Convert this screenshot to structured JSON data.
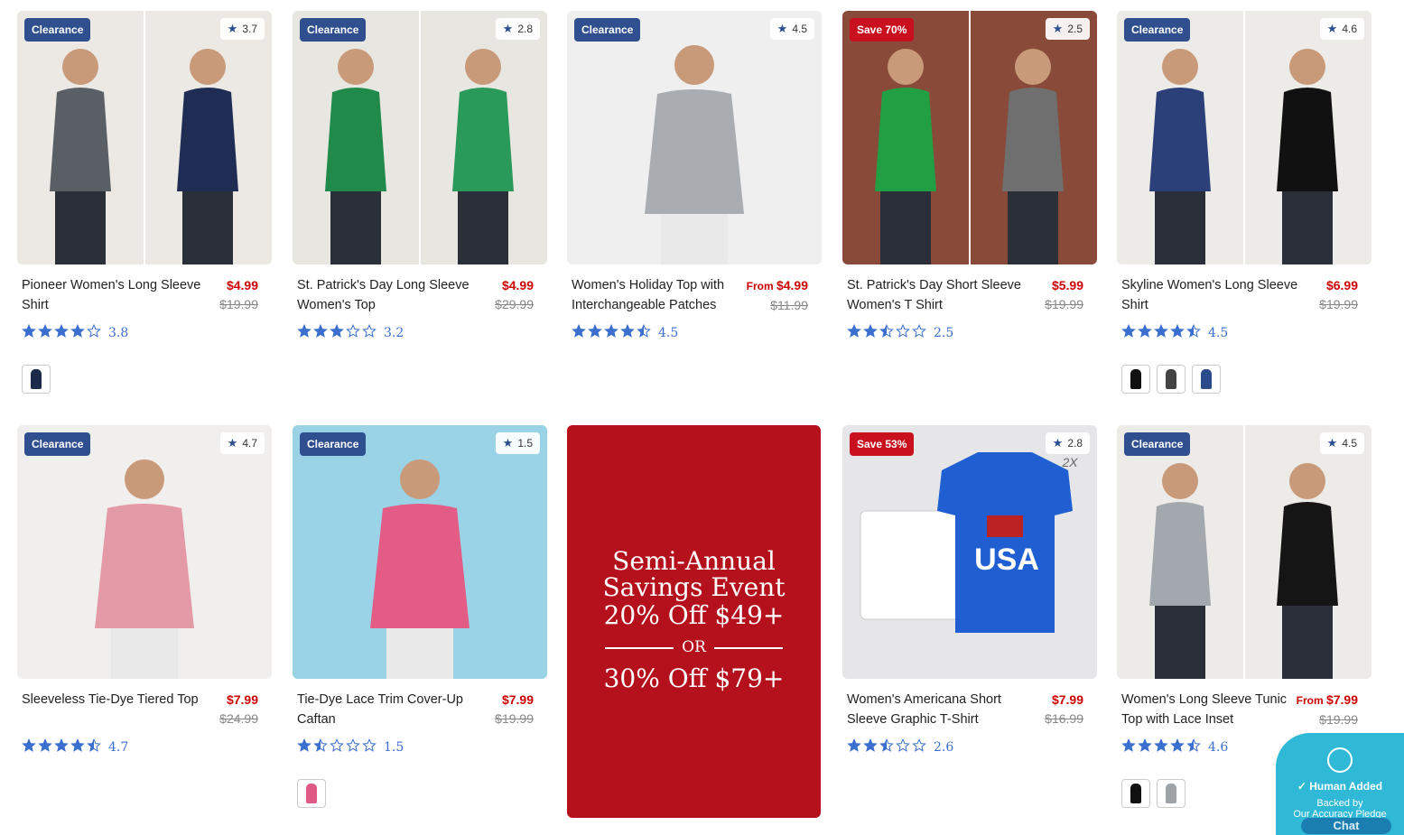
{
  "colors": {
    "clearance_badge": "#2f4f8f",
    "save_badge": "#c8101e",
    "price_red": "#cc0000",
    "star_blue": "#3a6ecf",
    "promo_bg": "#b5111c"
  },
  "products": [
    {
      "badge": "Clearance",
      "badge_type": "clearance",
      "rating": "3.7",
      "name": "Pioneer Women's Long Sleeve Shirt",
      "price_prefix": "",
      "price": "$4.99",
      "was": "$19.99",
      "stars_value": 3.8,
      "rating_text": "3.8",
      "swatch_colors": [
        "#1c2a4a"
      ],
      "art": [
        "#5a5f66",
        "#1f2d55"
      ],
      "bg": "#ece9e4"
    },
    {
      "badge": "Clearance",
      "badge_type": "clearance",
      "rating": "2.8",
      "name": "St. Patrick's Day Long Sleeve Women's Top",
      "price_prefix": "",
      "price": "$4.99",
      "was": "$29.99",
      "stars_value": 3.2,
      "rating_text": "3.2",
      "swatch_colors": [],
      "art": [
        "#1f8a4a",
        "#2a9a5a"
      ],
      "bg": "#e8e6e0"
    },
    {
      "badge": "Clearance",
      "badge_type": "clearance",
      "rating": "4.5",
      "name": "Women's Holiday Top with Interchangeable Patches",
      "price_prefix": "From ",
      "price": "$4.99",
      "was": "$11.99",
      "stars_value": 4.5,
      "rating_text": "4.5",
      "swatch_colors": [],
      "art": [
        "#a9acb1"
      ],
      "bg": "#efefef"
    },
    {
      "badge": "Save 70%",
      "badge_type": "save",
      "rating": "2.5",
      "name": "St. Patrick's Day Short Sleeve Women's T Shirt",
      "price_prefix": "",
      "price": "$5.99",
      "was": "$19.99",
      "stars_value": 2.5,
      "rating_text": "2.5",
      "swatch_colors": [],
      "art": [
        "#21a043",
        "#6f6f6f"
      ],
      "bg": "#8a4a3a"
    },
    {
      "badge": "Clearance",
      "badge_type": "clearance",
      "rating": "4.6",
      "name": "Skyline Women's Long Sleeve Shirt",
      "price_prefix": "",
      "price": "$6.99",
      "was": "$19.99",
      "stars_value": 4.5,
      "rating_text": "4.5",
      "swatch_colors": [
        "#111111",
        "#444444",
        "#2b4a8a"
      ],
      "art": [
        "#2b3f78",
        "#111111"
      ],
      "bg": "#ecebe8"
    },
    {
      "badge": "Clearance",
      "badge_type": "clearance",
      "rating": "4.7",
      "name": "Sleeveless Tie-Dye Tiered Top",
      "price_prefix": "",
      "price": "$7.99",
      "was": "$24.99",
      "stars_value": 4.7,
      "rating_text": "4.7",
      "swatch_colors": [],
      "art": [
        "#e49aa6"
      ],
      "bg": "#f0efed"
    },
    {
      "badge": "Clearance",
      "badge_type": "clearance",
      "rating": "1.5",
      "name": "Tie-Dye Lace Trim Cover-Up Caftan",
      "price_prefix": "",
      "price": "$7.99",
      "was": "$19.99",
      "stars_value": 1.5,
      "rating_text": "1.5",
      "swatch_colors": [
        "#e05a86"
      ],
      "art": [
        "#e25c86"
      ],
      "bg": "#9ad3e6"
    },
    {
      "badge": "Save 53%",
      "badge_type": "save",
      "rating": "2.8",
      "name": "Women's Americana Short Sleeve Graphic T-Shirt",
      "price_prefix": "",
      "price": "$7.99",
      "was": "$16.99",
      "stars_value": 2.6,
      "rating_text": "2.6",
      "swatch_colors": [],
      "art": [
        "#1f5fd1",
        "#ffffff"
      ],
      "bg": "#e6e6e8",
      "corner_text": "2X"
    },
    {
      "badge": "Clearance",
      "badge_type": "clearance",
      "rating": "4.5",
      "name": "Women's Long Sleeve Tunic Top with Lace Inset",
      "price_prefix": "From ",
      "price": "$7.99",
      "was": "$19.99",
      "stars_value": 4.6,
      "rating_text": "4.6",
      "swatch_colors": [
        "#111111",
        "#9ea3a8"
      ],
      "art": [
        "#a3a8ae",
        "#151515"
      ],
      "bg": "#ecebe8"
    }
  ],
  "promo": {
    "line1": "Semi-Annual",
    "line2": "Savings Event",
    "offer1": "20% Off $49+",
    "or": "OR",
    "offer2": "30% Off $79+"
  },
  "pledge": {
    "title": "Human Added",
    "sub1": "Backed by",
    "sub2": "Our Accuracy Pledge",
    "chat": "Chat"
  }
}
